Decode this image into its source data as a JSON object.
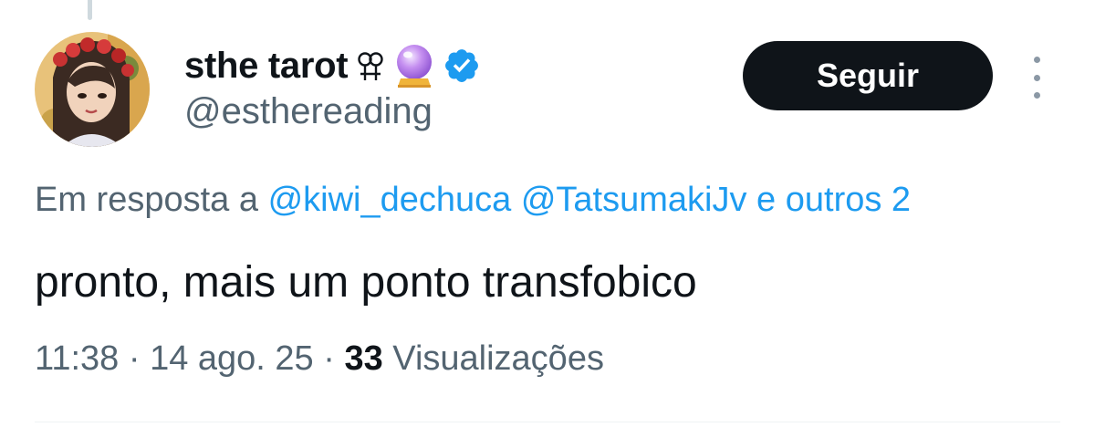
{
  "tweet": {
    "author": {
      "display_name": "sthe tarot",
      "name_emoji_1": "sapphic-symbol-icon",
      "name_emoji_2": "crystal-ball-icon",
      "verified_icon": "verified-badge-icon",
      "handle": "@esthereading"
    },
    "follow_button_label": "Seguir",
    "more_icon": "more-vertical-icon",
    "reply_to": {
      "prefix": "Em resposta a",
      "mentions": [
        "@kiwi_dechuca",
        "@TatsumakiJv"
      ],
      "suffix": "e outros 2"
    },
    "text": "pronto, mais um ponto transfobico",
    "meta": {
      "time": "11:38",
      "date": "14 ago. 25",
      "separator": "·",
      "views_count": "33",
      "views_label": "Visualizações"
    },
    "colors": {
      "link": "#1d9bf0",
      "secondary_text": "#536471",
      "primary_text": "#0f1419",
      "button_bg": "#0f1419",
      "verified": "#1d9bf0"
    }
  }
}
